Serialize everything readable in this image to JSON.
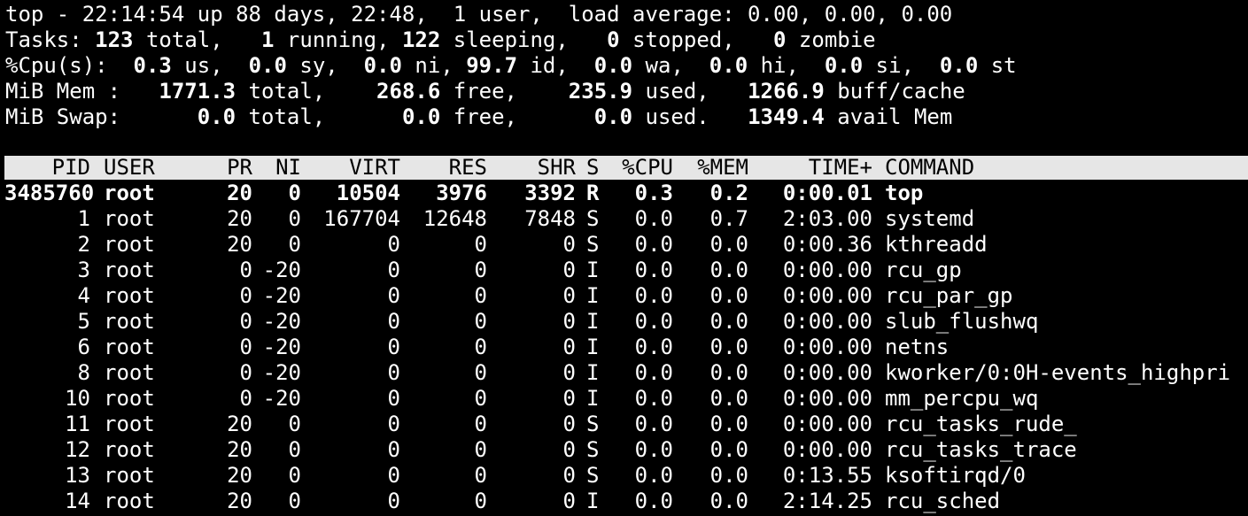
{
  "summary": {
    "l1": {
      "pre": "top - 22:14:54 up 88 days, 22:48,  1 user,  load average: 0.00, 0.00, 0.00"
    },
    "l2": {
      "label": "Tasks: ",
      "total": "123",
      "t_total": " total,   ",
      "running": "1",
      "t_running": " running, ",
      "sleeping": "122",
      "t_sleeping": " sleeping,   ",
      "stopped": "0",
      "t_stopped": " stopped,   ",
      "zombie": "0",
      "t_zombie": " zombie"
    },
    "l3": {
      "label": "%Cpu(s):  ",
      "us": "0.3",
      "t_us": " us,  ",
      "sy": "0.0",
      "t_sy": " sy,  ",
      "ni": "0.0",
      "t_ni": " ni, ",
      "id": "99.7",
      "t_id": " id,  ",
      "wa": "0.0",
      "t_wa": " wa,  ",
      "hi": "0.0",
      "t_hi": " hi,  ",
      "si": "0.0",
      "t_si": " si,  ",
      "st": "0.0",
      "t_st": " st"
    },
    "l4": {
      "label": "MiB Mem :   ",
      "total": "1771.3",
      "t_total": " total,    ",
      "free": "268.6",
      "t_free": " free,    ",
      "used": "235.9",
      "t_used": " used,   ",
      "buff": "1266.9",
      "t_buff": " buff/cache"
    },
    "l5": {
      "label": "MiB Swap:      ",
      "total": "0.0",
      "t_total": " total,      ",
      "free": "0.0",
      "t_free": " free,      ",
      "used": "0.0",
      "t_used": " used.   ",
      "avail": "1349.4",
      "t_avail": " avail Mem"
    }
  },
  "columns": [
    "PID",
    "USER",
    "PR",
    "NI",
    "VIRT",
    "RES",
    "SHR",
    "S",
    "%CPU",
    "%MEM",
    "TIME+",
    "COMMAND"
  ],
  "processes": [
    {
      "pid": "3485760",
      "user": "root",
      "pr": "20",
      "ni": "0",
      "virt": "10504",
      "res": "3976",
      "shr": "3392",
      "s": "R",
      "cpu": "0.3",
      "mem": "0.2",
      "time": "0:00.01",
      "cmd": "top"
    },
    {
      "pid": "1",
      "user": "root",
      "pr": "20",
      "ni": "0",
      "virt": "167704",
      "res": "12648",
      "shr": "7848",
      "s": "S",
      "cpu": "0.0",
      "mem": "0.7",
      "time": "2:03.00",
      "cmd": "systemd"
    },
    {
      "pid": "2",
      "user": "root",
      "pr": "20",
      "ni": "0",
      "virt": "0",
      "res": "0",
      "shr": "0",
      "s": "S",
      "cpu": "0.0",
      "mem": "0.0",
      "time": "0:00.36",
      "cmd": "kthreadd"
    },
    {
      "pid": "3",
      "user": "root",
      "pr": "0",
      "ni": "-20",
      "virt": "0",
      "res": "0",
      "shr": "0",
      "s": "I",
      "cpu": "0.0",
      "mem": "0.0",
      "time": "0:00.00",
      "cmd": "rcu_gp"
    },
    {
      "pid": "4",
      "user": "root",
      "pr": "0",
      "ni": "-20",
      "virt": "0",
      "res": "0",
      "shr": "0",
      "s": "I",
      "cpu": "0.0",
      "mem": "0.0",
      "time": "0:00.00",
      "cmd": "rcu_par_gp"
    },
    {
      "pid": "5",
      "user": "root",
      "pr": "0",
      "ni": "-20",
      "virt": "0",
      "res": "0",
      "shr": "0",
      "s": "I",
      "cpu": "0.0",
      "mem": "0.0",
      "time": "0:00.00",
      "cmd": "slub_flushwq"
    },
    {
      "pid": "6",
      "user": "root",
      "pr": "0",
      "ni": "-20",
      "virt": "0",
      "res": "0",
      "shr": "0",
      "s": "I",
      "cpu": "0.0",
      "mem": "0.0",
      "time": "0:00.00",
      "cmd": "netns"
    },
    {
      "pid": "8",
      "user": "root",
      "pr": "0",
      "ni": "-20",
      "virt": "0",
      "res": "0",
      "shr": "0",
      "s": "I",
      "cpu": "0.0",
      "mem": "0.0",
      "time": "0:00.00",
      "cmd": "kworker/0:0H-events_highpri"
    },
    {
      "pid": "10",
      "user": "root",
      "pr": "0",
      "ni": "-20",
      "virt": "0",
      "res": "0",
      "shr": "0",
      "s": "I",
      "cpu": "0.0",
      "mem": "0.0",
      "time": "0:00.00",
      "cmd": "mm_percpu_wq"
    },
    {
      "pid": "11",
      "user": "root",
      "pr": "20",
      "ni": "0",
      "virt": "0",
      "res": "0",
      "shr": "0",
      "s": "S",
      "cpu": "0.0",
      "mem": "0.0",
      "time": "0:00.00",
      "cmd": "rcu_tasks_rude_"
    },
    {
      "pid": "12",
      "user": "root",
      "pr": "20",
      "ni": "0",
      "virt": "0",
      "res": "0",
      "shr": "0",
      "s": "S",
      "cpu": "0.0",
      "mem": "0.0",
      "time": "0:00.00",
      "cmd": "rcu_tasks_trace"
    },
    {
      "pid": "13",
      "user": "root",
      "pr": "20",
      "ni": "0",
      "virt": "0",
      "res": "0",
      "shr": "0",
      "s": "S",
      "cpu": "0.0",
      "mem": "0.0",
      "time": "0:13.55",
      "cmd": "ksoftirqd/0"
    },
    {
      "pid": "14",
      "user": "root",
      "pr": "20",
      "ni": "0",
      "virt": "0",
      "res": "0",
      "shr": "0",
      "s": "I",
      "cpu": "0.0",
      "mem": "0.0",
      "time": "2:14.25",
      "cmd": "rcu_sched"
    }
  ],
  "colors": {
    "background": "#000000",
    "foreground": "#ffffff",
    "header_bar": "#e6e6e6",
    "header_text": "#000000"
  }
}
